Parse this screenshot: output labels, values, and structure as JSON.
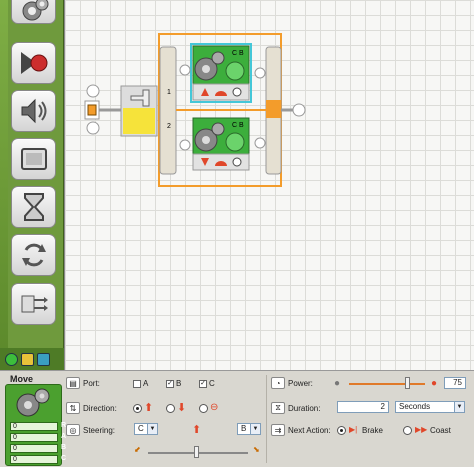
{
  "palette": {
    "items": [
      "move-block",
      "record-play-block",
      "sound-block",
      "display-block",
      "wait-block",
      "loop-block",
      "switch-block"
    ]
  },
  "canvas": {
    "top_motor_ports": "C B",
    "bottom_motor_ports": "C B",
    "switch_case_top": "1",
    "switch_case_bottom": "2"
  },
  "panel": {
    "title": "Move",
    "block_ports": [
      {
        "value": "0",
        "port": "R"
      },
      {
        "value": "0",
        "port": "A"
      },
      {
        "value": "0",
        "port": "B"
      },
      {
        "value": "0",
        "port": "C"
      }
    ],
    "port": {
      "label": "Port:",
      "a": "A",
      "b": "B",
      "c": "C",
      "a_checked": false,
      "b_checked": true,
      "c_checked": true
    },
    "direction": {
      "label": "Direction:",
      "selected": "forward"
    },
    "steering": {
      "label": "Steering:",
      "left": "C",
      "right": "B"
    },
    "power": {
      "label": "Power:",
      "value": "75",
      "level": 0.75
    },
    "duration": {
      "label": "Duration:",
      "value": "2",
      "unit": "Seconds"
    },
    "next_action": {
      "label": "Next Action:",
      "brake": "Brake",
      "coast": "Coast",
      "selected": "Brake"
    }
  },
  "colors": {
    "accent": "#f39c2b",
    "block_green": "#3cae3c",
    "palette_green": "#6f9a3d"
  }
}
